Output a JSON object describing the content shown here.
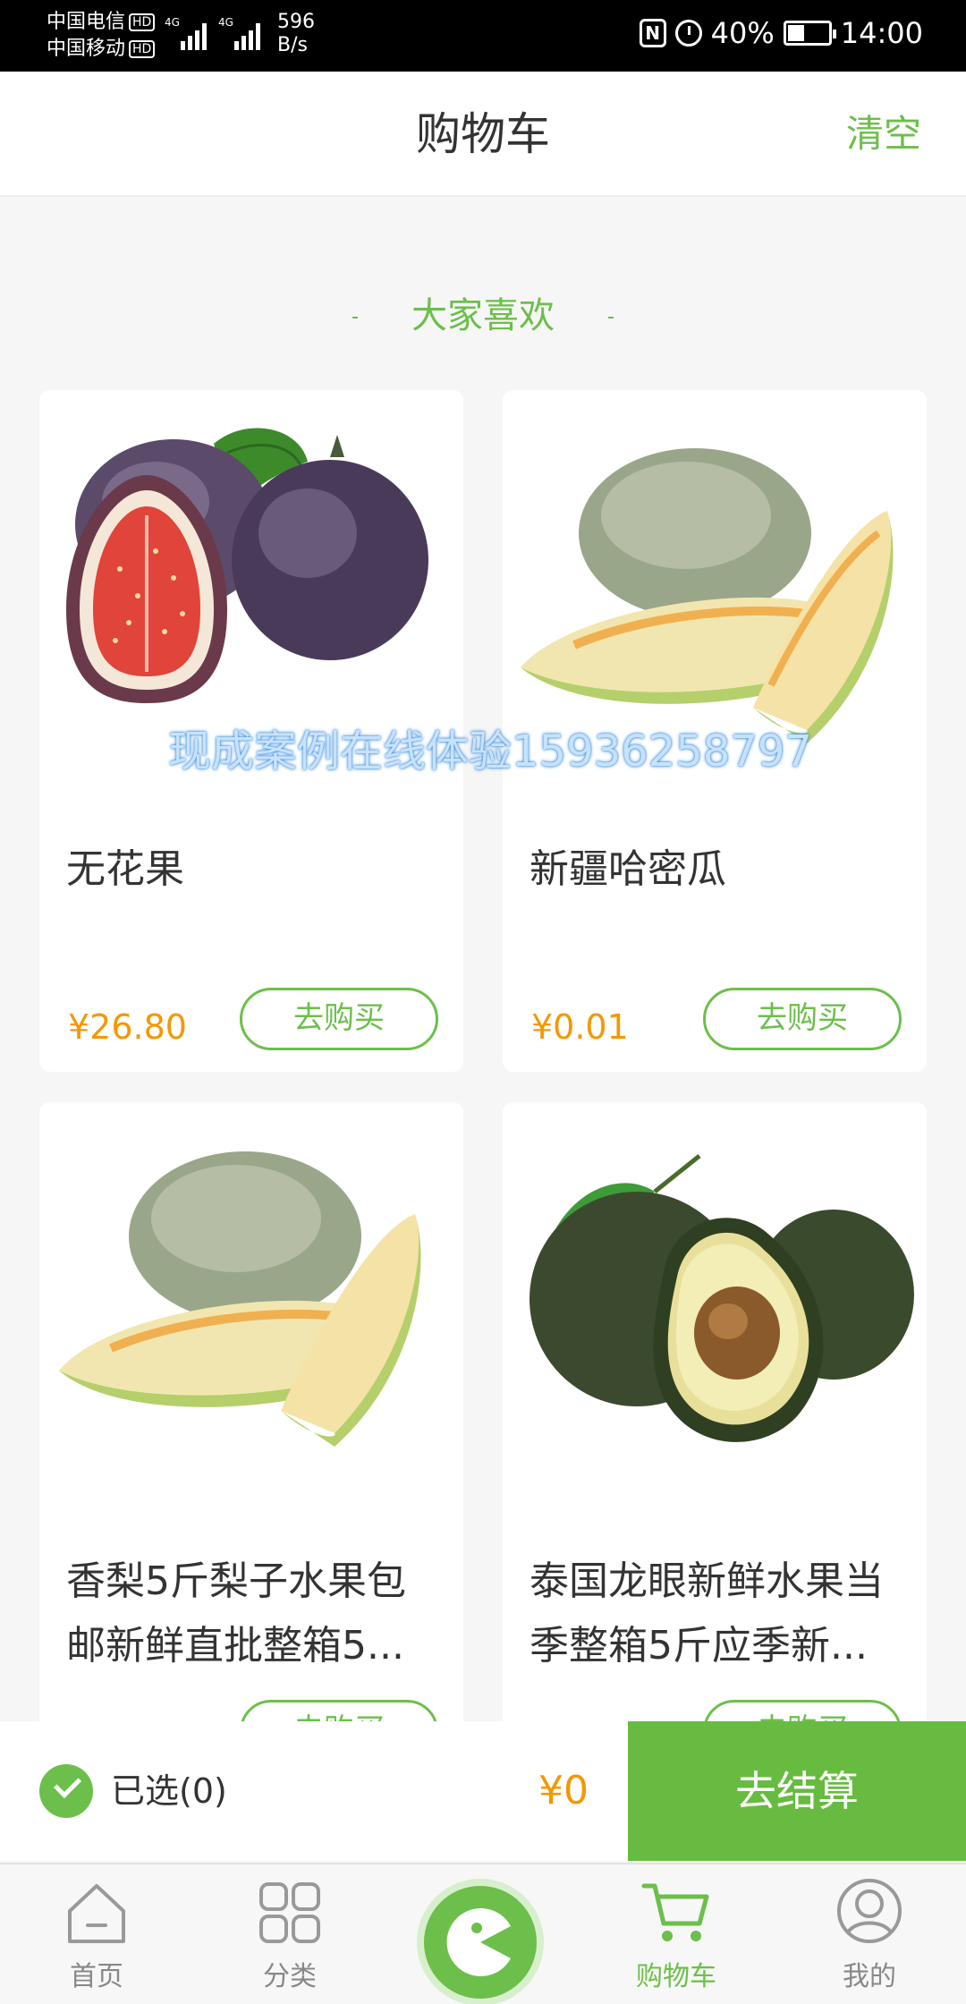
{
  "status_bar": {
    "carrier1": "中国电信",
    "carrier2": "中国移动",
    "hd": "HD",
    "network": "4G",
    "net_speed_value": "596",
    "net_speed_unit": "B/s",
    "battery": "40%",
    "battery_level": 0.4,
    "time": "14:00"
  },
  "header": {
    "title": "购物车",
    "clear_label": "清空"
  },
  "section": {
    "title": "大家喜欢"
  },
  "watermark": "现成案例在线体验15936258797",
  "products": [
    {
      "name": "无花果",
      "price": "¥26.80",
      "buy_label": "去购买",
      "image": "fig-image"
    },
    {
      "name": "新疆哈密瓜",
      "price": "¥0.01",
      "buy_label": "去购买",
      "image": "melon-image"
    },
    {
      "name": "香梨5斤梨子水果包邮新鲜直批整箱5...",
      "price": "",
      "buy_label": "去购买",
      "image": "melon-image"
    },
    {
      "name": "泰国龙眼新鲜水果当季整箱5斤应季新...",
      "price": "",
      "buy_label": "去购买",
      "image": "avocado-image"
    }
  ],
  "cart_bar": {
    "selected_label": "已选(0)",
    "total": "¥0",
    "checkout_label": "去结算"
  },
  "tabbar": {
    "items": [
      {
        "label": "首页",
        "icon": "home-icon"
      },
      {
        "label": "分类",
        "icon": "category-icon"
      },
      {
        "label": "",
        "icon": "pacman-logo-icon"
      },
      {
        "label": "购物车",
        "icon": "cart-icon",
        "active": true
      },
      {
        "label": "我的",
        "icon": "user-icon"
      }
    ]
  },
  "colors": {
    "accent": "#6cbf4a",
    "price": "#f39800"
  }
}
